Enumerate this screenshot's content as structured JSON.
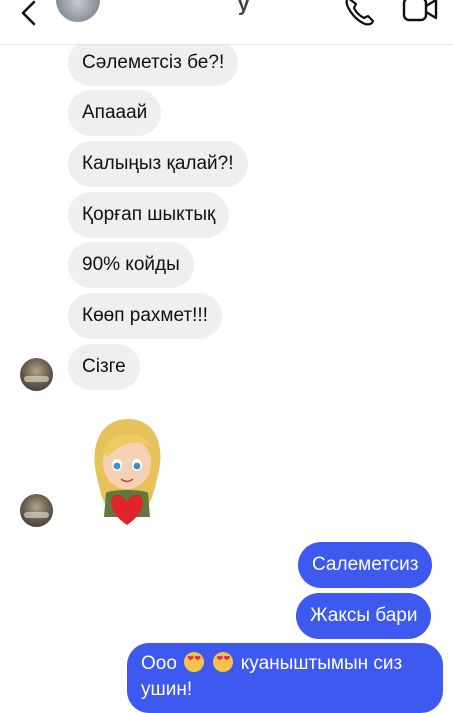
{
  "header": {
    "contact_name": "у",
    "back_icon": "chevron-left-icon",
    "call_icon": "phone-icon",
    "video_icon": "video-camera-icon"
  },
  "messages": {
    "incoming": [
      "Сәлеметсіз бе?!",
      "Апааай",
      "Калыңыз қалай?!",
      "Қорғап шыктық",
      "90% койды",
      "Көөп рахмет!!!",
      "Сізге"
    ],
    "outgoing": [
      "Салеметсиз",
      "Жаксы бари",
      "куаныштымын сиз ушин!"
    ],
    "last_prefix": "Ооо"
  },
  "colors": {
    "incoming_bubble": "#efefef",
    "outgoing_bubble": "#3d59f0"
  }
}
